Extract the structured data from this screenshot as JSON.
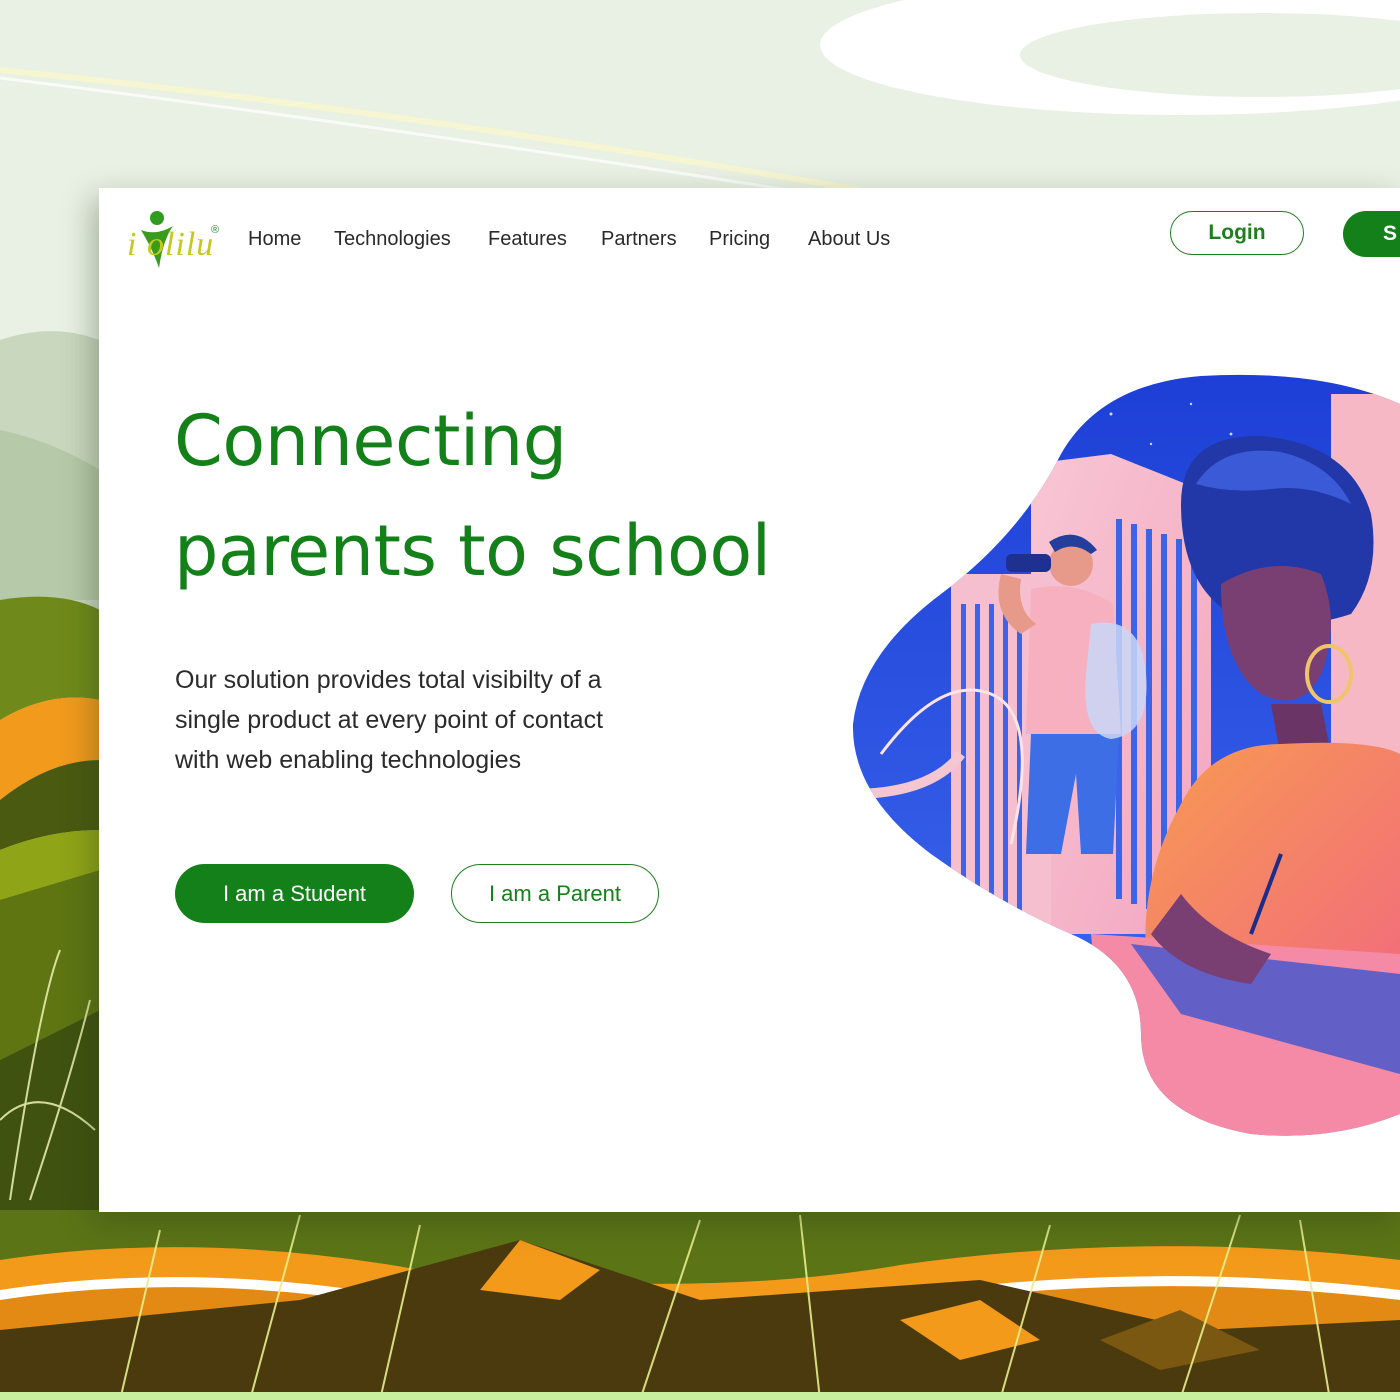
{
  "brand": {
    "logo_text": "i olilu",
    "registered_mark": "®"
  },
  "nav": {
    "items": [
      {
        "label": "Home"
      },
      {
        "label": "Technologies"
      },
      {
        "label": "Features"
      },
      {
        "label": "Partners"
      },
      {
        "label": "Pricing"
      },
      {
        "label": "About Us"
      }
    ],
    "login_label": "Login",
    "signup_label": "S"
  },
  "hero": {
    "title_line1": "Connecting",
    "title_line2": "parents to school",
    "description_line1": "Our solution provides total visibilty of a",
    "description_line2": "single product at every point of contact",
    "description_line3": "with web enabling technologies",
    "student_button": "I am a Student",
    "parent_button": "I am a Parent",
    "illustration": "students-in-city-illustration"
  },
  "colors": {
    "brand_green": "#13801a",
    "logo_yellow": "#c6c81e",
    "text_dark": "#2a2a2a",
    "background_mint": "#e8efe3",
    "illustration_blue": "#2f55e0",
    "illustration_orange": "#f6934a",
    "illustration_pink": "#f7b8c6"
  }
}
